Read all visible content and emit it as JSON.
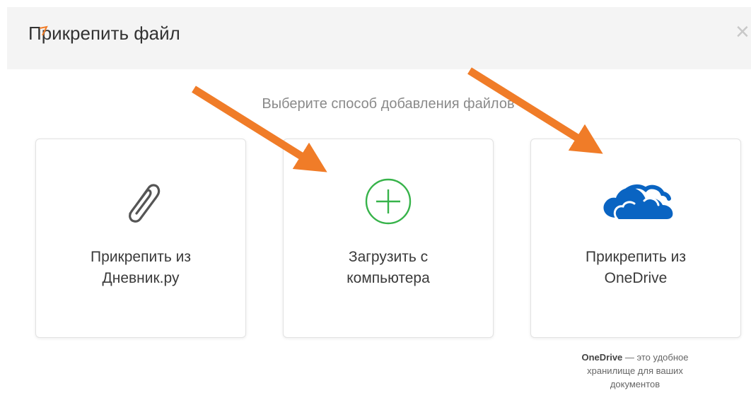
{
  "dialog": {
    "title": "Прикрепить файл",
    "close_symbol": "×",
    "subtitle": "Выберите способ добавления файлов"
  },
  "options": [
    {
      "icon": "paperclip-icon",
      "label_line1": "Прикрепить из",
      "label_line2": "Дневник.ру"
    },
    {
      "icon": "plus-circle-icon",
      "label_line1": "Загрузить с",
      "label_line2": "компьютера"
    },
    {
      "icon": "onedrive-cloud-icon",
      "label_line1": "Прикрепить из",
      "label_line2": "OneDrive"
    }
  ],
  "footnote": {
    "brand": "OneDrive",
    "line1_rest": " — это удобное",
    "line2": "хранилище для ваших",
    "line3": "документов"
  },
  "colors": {
    "header_bg": "#f4f4f4",
    "plus_green": "#37b34a",
    "onedrive_blue": "#0a64c2",
    "annotation_arrow": "#f07c28"
  }
}
